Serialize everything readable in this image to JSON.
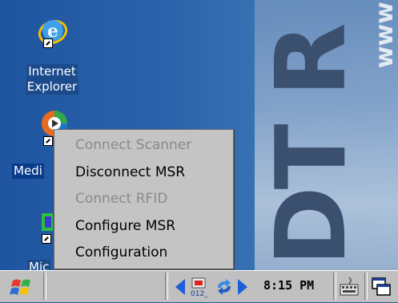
{
  "desktop": {
    "icons": [
      {
        "label_line1": "Internet",
        "label_line2": "Explorer",
        "icon": "internet-explorer-icon"
      },
      {
        "label": "Medi",
        "icon": "media-player-icon"
      },
      {
        "label": "Mic",
        "icon": "microsoft-app-icon"
      }
    ],
    "brand": "DT R",
    "brand_small": "www"
  },
  "context_menu": {
    "items": [
      {
        "label": "Connect Scanner",
        "enabled": false
      },
      {
        "label": "Disconnect MSR",
        "enabled": true
      },
      {
        "label": "Connect RFID",
        "enabled": false
      },
      {
        "label": "Configure MSR",
        "enabled": true
      },
      {
        "label": "Configuration",
        "enabled": true
      }
    ]
  },
  "taskbar": {
    "start_icon": "windows-flag-icon",
    "clock": "8:15 PM",
    "tray_icons": [
      "scanner-tray-icon",
      "sync-arrows-icon",
      "keyboard-icon",
      "desktop-switch-icon"
    ],
    "scanner_badge": "012_"
  },
  "colors": {
    "desktop": "#2a5d9c",
    "menu_bg": "#c4c4c4",
    "taskbar_bg": "#c0c0c0",
    "disabled_text": "#8a8a8a"
  }
}
